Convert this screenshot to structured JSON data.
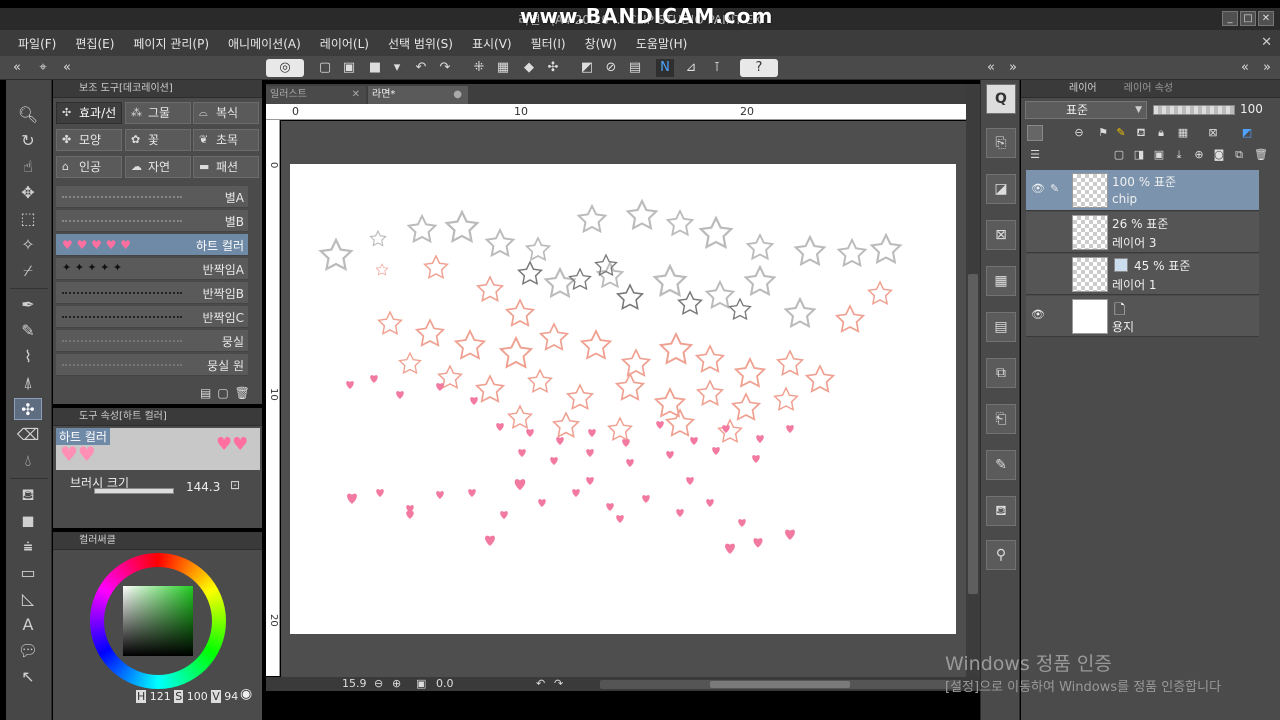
{
  "window": {
    "title": "라면* (A4 20.20 ... CLIP STUDIO PAINT EX",
    "watermark": "www.BANDICAM.com"
  },
  "menu": [
    "파일(F)",
    "편집(E)",
    "페이지 관리(P)",
    "애니메이션(A)",
    "레이어(L)",
    "선택 범위(S)",
    "표시(V)",
    "필터(I)",
    "창(W)",
    "도움말(H)"
  ],
  "subtool_panel": {
    "title": "보조 도구[데코레이션]",
    "groups": [
      "효과/선",
      "그물",
      "복식",
      "모양",
      "꽃",
      "초목",
      "인공",
      "자연",
      "패션"
    ],
    "brushes": [
      "별A",
      "별B",
      "하트 컬러",
      "반짝임A",
      "반짝임B",
      "반짝임C",
      "뭉실",
      "뭉실 원"
    ],
    "selected_brush": "하트 컬러"
  },
  "tool_property": {
    "title": "도구 속성[하트 컬러]",
    "brush_name": "하트 컬러",
    "size_label": "브러시 크기",
    "size_value": "144.3"
  },
  "color_panel": {
    "title": "컬러써클",
    "fg_color": "#2ecc40",
    "hsv": {
      "h_label": "H",
      "h": "121",
      "s_label": "S",
      "s": "100",
      "v_label": "V",
      "v": "94"
    }
  },
  "canvas": {
    "tabs": [
      {
        "label": "일러스트"
      },
      {
        "label": "라면*"
      }
    ],
    "ruler_h": [
      "0",
      "10",
      "20"
    ],
    "ruler_v": [
      "0",
      "10",
      "20"
    ],
    "zoom": "15.9",
    "angle": "0.0"
  },
  "layer_panel": {
    "tabs": [
      "레이어",
      "레이어 속성"
    ],
    "blend_mode": "표준",
    "opacity": "100",
    "layers": [
      {
        "line1": "100 % 표준",
        "line2": "chip"
      },
      {
        "line1": "26 % 표준",
        "line2": "레이어 3"
      },
      {
        "line1": "45 % 표준",
        "line2": "레이어 1"
      },
      {
        "line1": "",
        "line2": "용지"
      }
    ]
  },
  "windows_activation": {
    "line1": "Windows 정품 인증",
    "line2": "[설정]으로 이동하여 Windows를 정품 인증합니다"
  }
}
